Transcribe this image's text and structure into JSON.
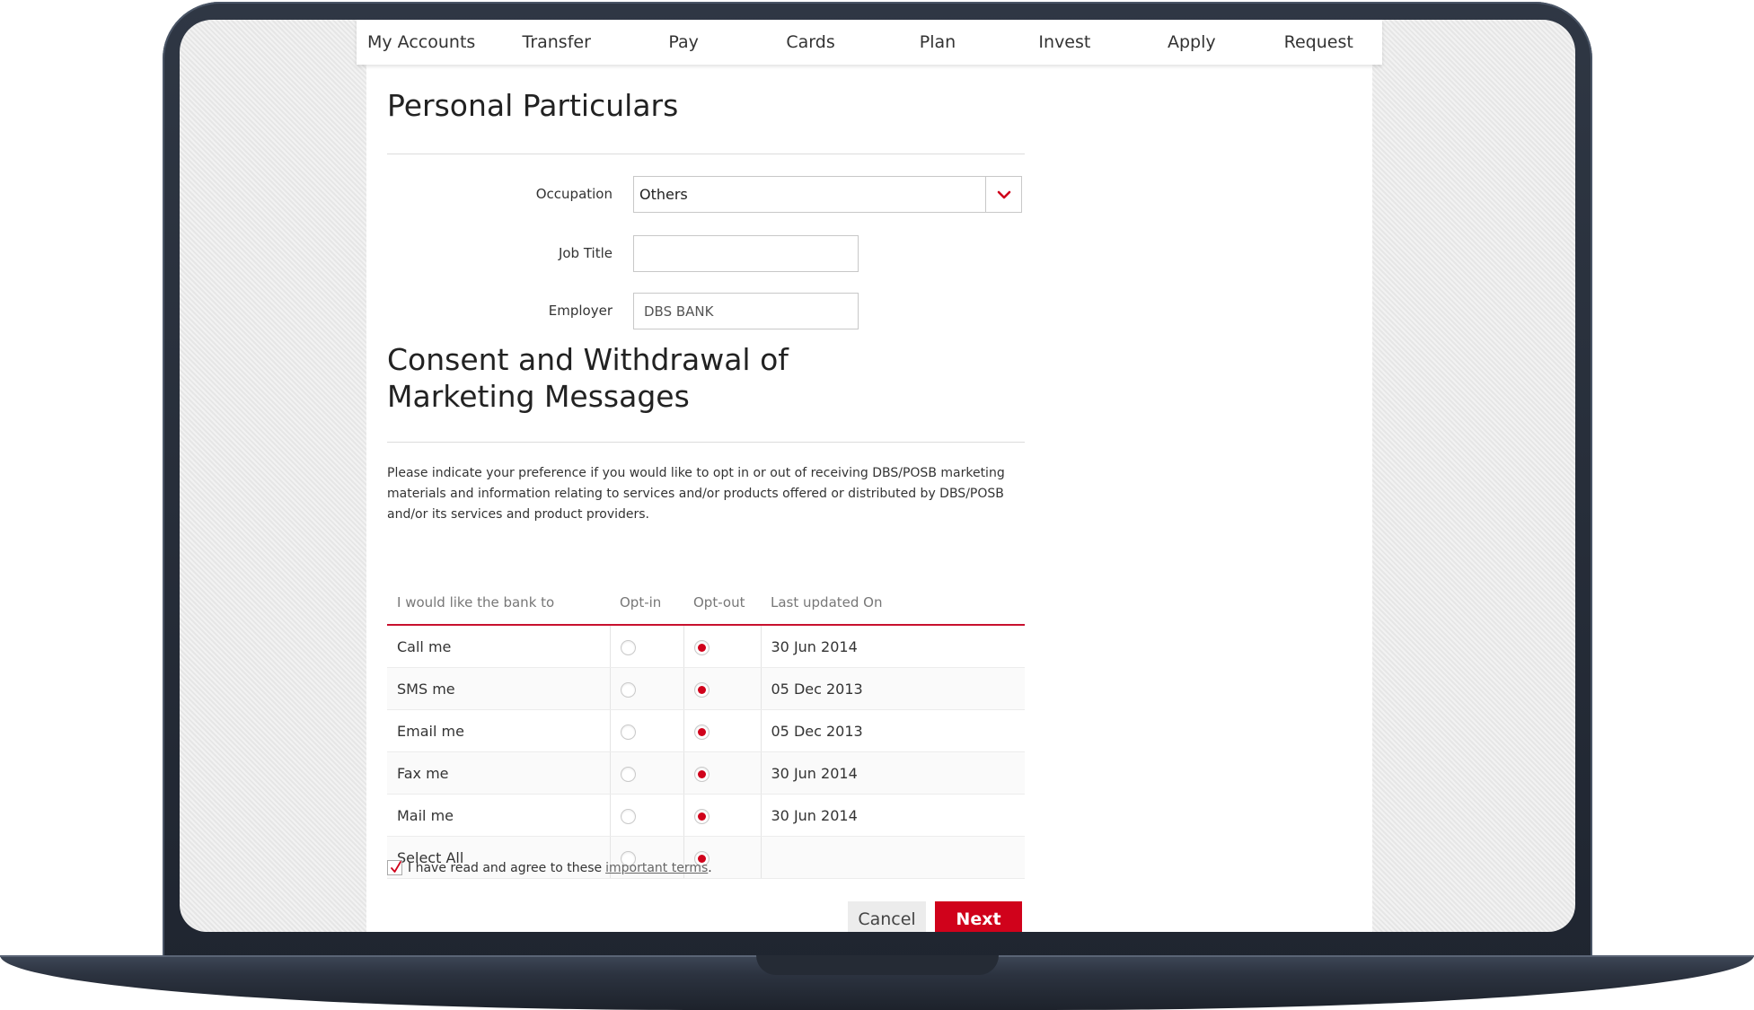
{
  "nav": {
    "items": [
      "My Accounts",
      "Transfer",
      "Pay",
      "Cards",
      "Plan",
      "Invest",
      "Apply",
      "Request"
    ]
  },
  "personal": {
    "title": "Personal Particulars",
    "occupation": {
      "label": "Occupation",
      "value": "Others"
    },
    "job_title": {
      "label": "Job Title",
      "value": ""
    },
    "employer": {
      "label": "Employer",
      "value": "DBS BANK"
    }
  },
  "consent": {
    "title": "Consent and Withdrawal of Marketing Messages",
    "description": "Please indicate your preference if you would like to opt in or out of receiving DBS/POSB marketing materials and information relating to services and/or products offered or distributed by DBS/POSB and/or its services and product providers.",
    "headers": [
      "I would like the bank to",
      "Opt-in",
      "Opt-out",
      "Last updated On"
    ],
    "rows": [
      {
        "label": "Call me",
        "choice": "opt-out",
        "updated": "30 Jun 2014"
      },
      {
        "label": "SMS me",
        "choice": "opt-out",
        "updated": "05 Dec 2013"
      },
      {
        "label": "Email me",
        "choice": "opt-out",
        "updated": "05 Dec 2013"
      },
      {
        "label": "Fax me",
        "choice": "opt-out",
        "updated": "30 Jun 2014"
      },
      {
        "label": "Mail me",
        "choice": "opt-out",
        "updated": "30 Jun 2014"
      },
      {
        "label": "Select All",
        "choice": "opt-out",
        "updated": ""
      }
    ],
    "agree_text": "I have read and agree to these",
    "terms_link": "important terms",
    "agree_suffix": ".",
    "agree_checked": true
  },
  "actions": {
    "cancel": "Cancel",
    "next": "Next"
  },
  "colors": {
    "accent": "#d0021b"
  },
  "icons": {
    "dropdown": "chevron-down-icon",
    "check": "check-icon"
  }
}
